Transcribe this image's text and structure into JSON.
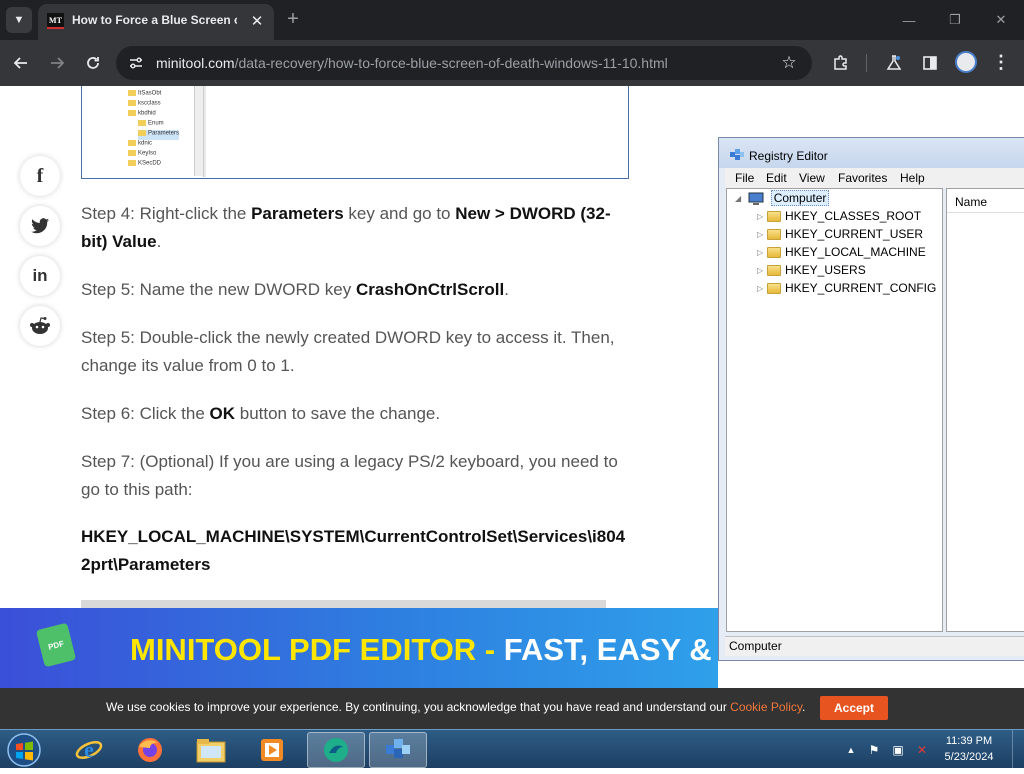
{
  "browser": {
    "tab": {
      "favicon_text": "MT",
      "title": "How to Force a Blue Screen of Death",
      "close": "✕"
    },
    "new_tab": "+",
    "window_controls": {
      "minimize": "—",
      "restore": "❐",
      "close": "✕"
    },
    "url_domain": "minitool.com",
    "url_path": "/data-recovery/how-to-force-blue-screen-of-death-windows-11-10.html"
  },
  "snapshot": {
    "rows": [
      "ItSasObt",
      "kscclass",
      "kbdhid",
      "Enum",
      "Parameters",
      "kdnic",
      "KeyIso",
      "KSecDD"
    ]
  },
  "share": {
    "facebook": "f",
    "twitter": "t",
    "linkedin": "in",
    "reddit": "r"
  },
  "article": {
    "step4": {
      "a": "Step 4: Right-click the ",
      "b1": "Parameters",
      "c": " key and go to ",
      "b2": "New > DWORD (32-bit) Value",
      "d": "."
    },
    "step5a": {
      "a": "Step 5: Name the new DWORD key ",
      "b1": "CrashOnCtrlScroll",
      "c": "."
    },
    "step5b": {
      "a": "Step 5: Double-click the newly created DWORD key to access it. Then, change its value from 0 to 1."
    },
    "step6": {
      "a": "Step 6: Click the ",
      "b1": "OK",
      "c": " button to save the change."
    },
    "step7": {
      "a": "Step 7: (Optional) If you are using a legacy PS/2 keyboard, you need to go to this path:"
    },
    "path": "HKEY_LOCAL_MACHINE\\SYSTEM\\CurrentControlSet\\Services\\i8042prt\\Parameters"
  },
  "banner": {
    "logo": "PDF",
    "yellow": "MINITOOL PDF EDITOR - ",
    "white": "FAST, EASY &"
  },
  "cookie": {
    "text": "We use cookies to improve your experience. By continuing, you acknowledge that you have read and understand our ",
    "link": "Cookie Policy",
    "period": ".",
    "accept": "Accept"
  },
  "regedit": {
    "title": "Registry Editor",
    "menu": [
      "File",
      "Edit",
      "View",
      "Favorites",
      "Help"
    ],
    "root": "Computer",
    "keys": [
      "HKEY_CLASSES_ROOT",
      "HKEY_CURRENT_USER",
      "HKEY_LOCAL_MACHINE",
      "HKEY_USERS",
      "HKEY_CURRENT_CONFIG"
    ],
    "column_name": "Name",
    "status": "Computer"
  },
  "taskbar": {
    "clock_time": "11:39 PM",
    "clock_date": "5/23/2024",
    "tray_arrow": "▲",
    "tray_flag": "⚑",
    "tray_net": "▣",
    "tray_volume": "✕"
  }
}
